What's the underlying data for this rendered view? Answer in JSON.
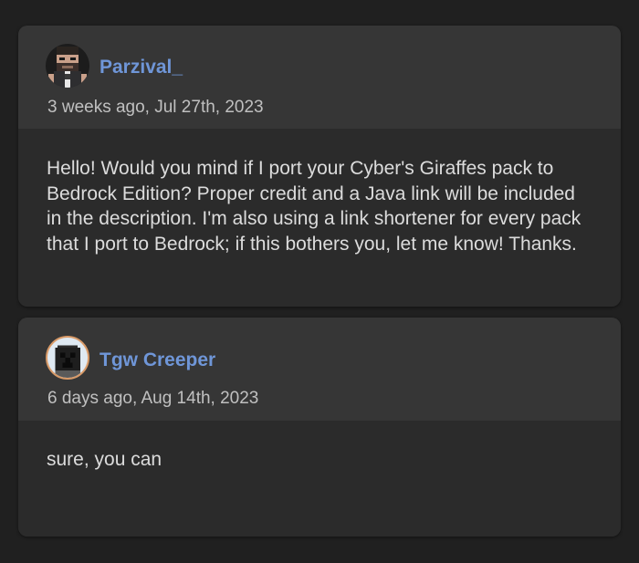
{
  "comments": [
    {
      "username": "Parzival_",
      "timestamp": "3 weeks ago, Jul 27th, 2023",
      "body": "Hello! Would you mind if I port your Cyber's Giraffes pack to Bedrock Edition? Proper credit and a Java link will be included in the description. I'm also using a link shortener for every pack that I port to Bedrock; if this bothers you, let me know! Thanks.",
      "avatar_icon": "pixel-character-avatar"
    },
    {
      "username": "Tgw Creeper",
      "timestamp": "6 days ago, Aug 14th, 2023",
      "body": "sure, you can",
      "avatar_icon": "creeper-head-avatar"
    }
  ],
  "colors": {
    "background": "#202020",
    "card_header": "#363636",
    "card_body": "#2b2b2b",
    "username": "#6f96d8",
    "timestamp": "#c0c0c0",
    "body_text": "#dcdcdc"
  }
}
